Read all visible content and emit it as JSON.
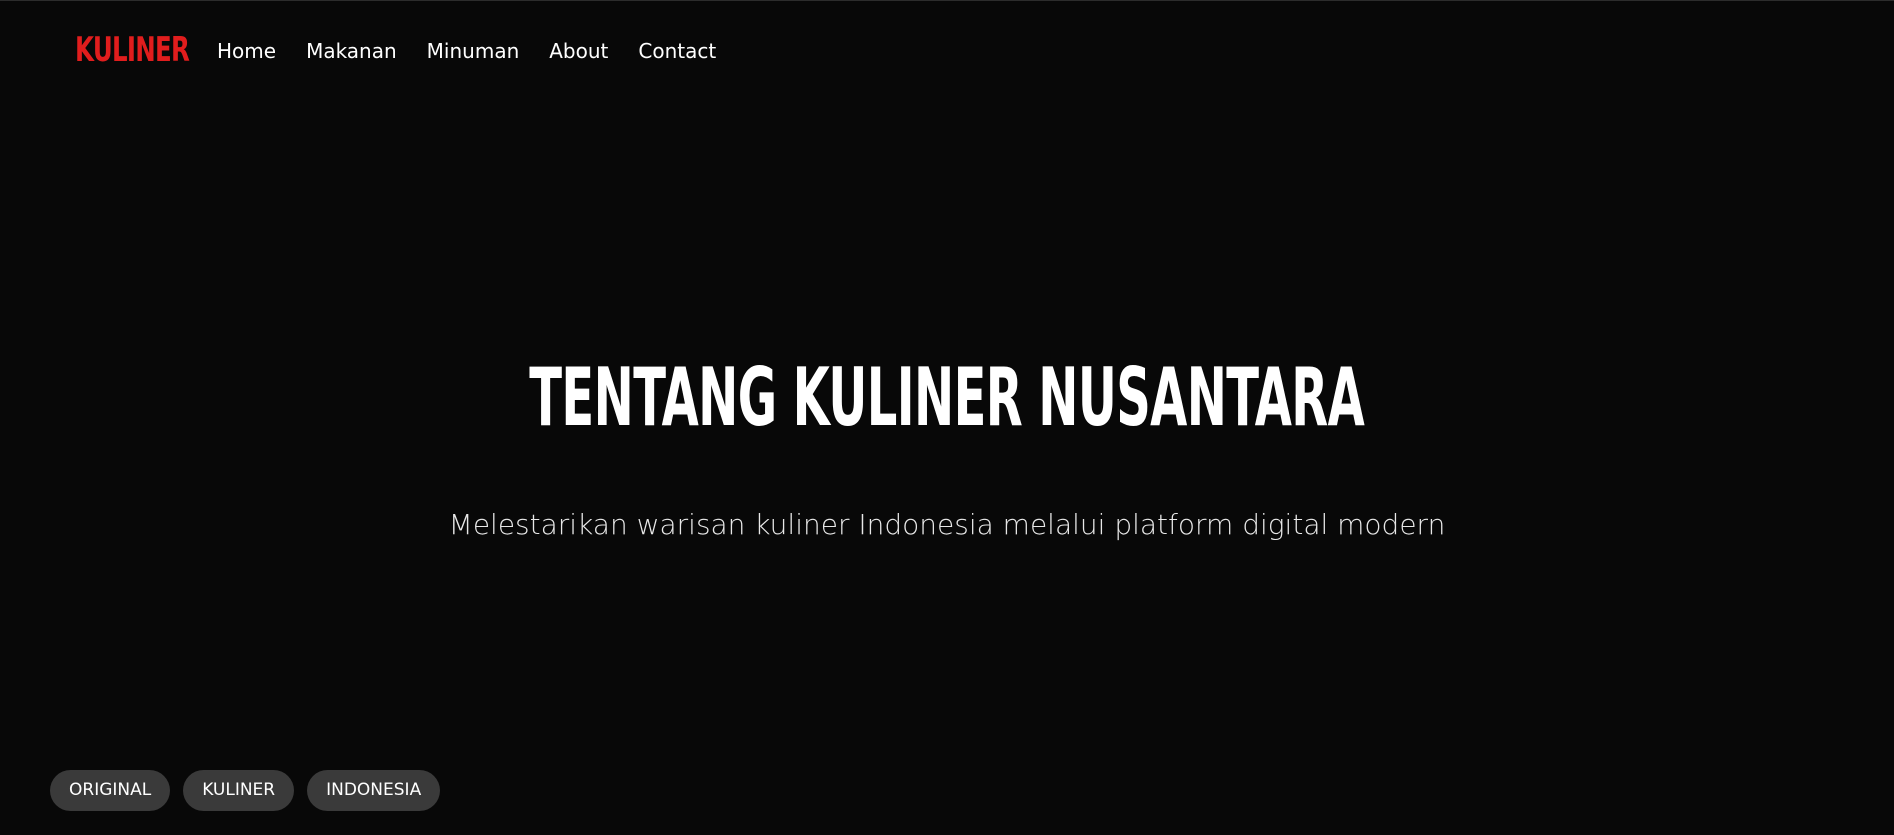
{
  "brand": {
    "logo_text": "KULINER",
    "accent_color": "#e11d1d"
  },
  "nav": {
    "items": [
      {
        "label": "Home"
      },
      {
        "label": "Makanan"
      },
      {
        "label": "Minuman"
      },
      {
        "label": "About"
      },
      {
        "label": "Contact"
      }
    ]
  },
  "hero": {
    "title": "TENTANG KULINER NUSANTARA",
    "subtitle": "Melestarikan warisan kuliner Indonesia melalui platform digital modern"
  },
  "tags": [
    {
      "label": "ORIGINAL"
    },
    {
      "label": "KULINER"
    },
    {
      "label": "INDONESIA"
    }
  ],
  "colors": {
    "background": "#080808",
    "tag_background": "#3a3a3a",
    "text": "#ffffff"
  }
}
